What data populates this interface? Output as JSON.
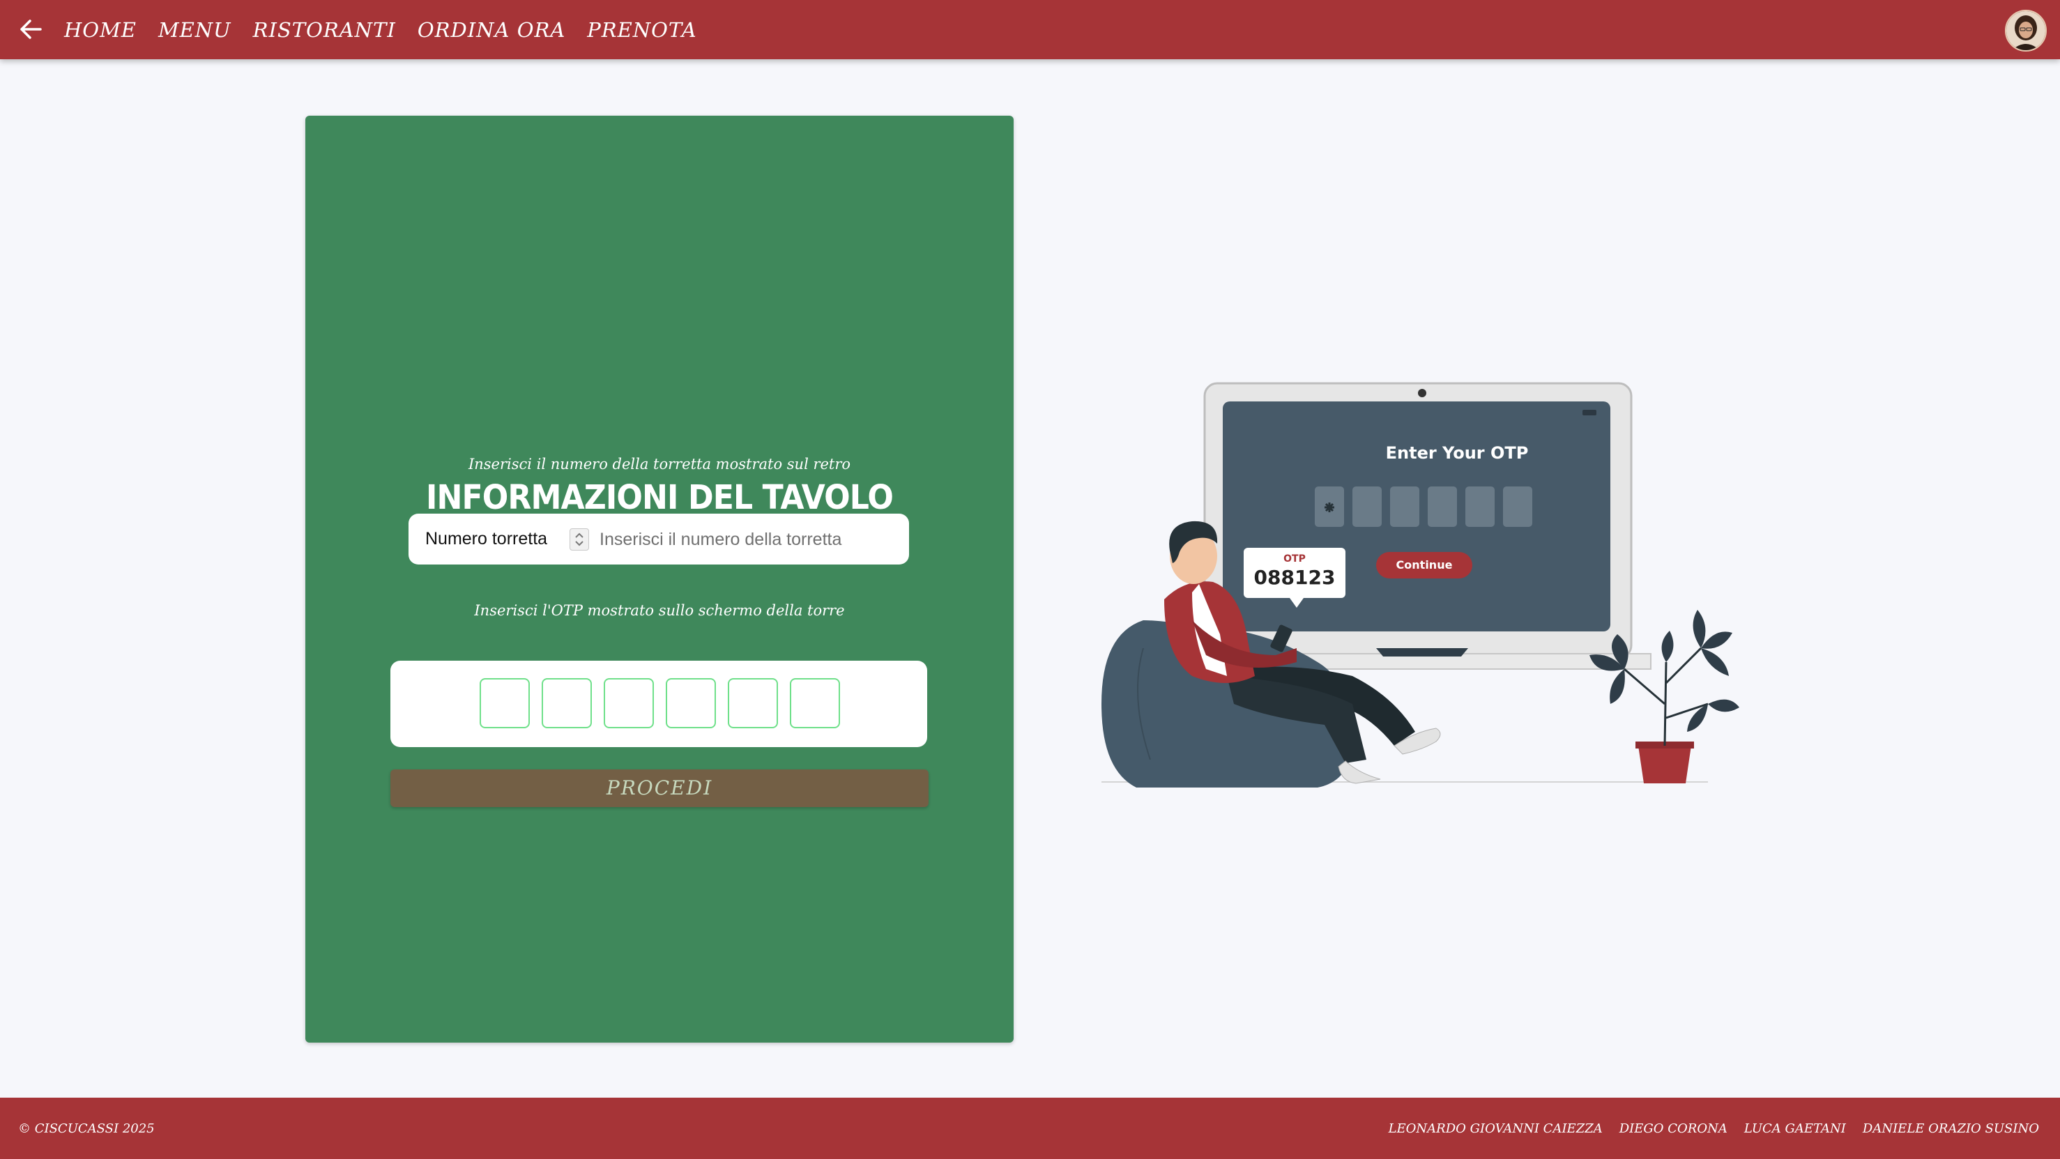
{
  "nav": {
    "back_icon": "arrow-left-icon",
    "links": [
      "HOME",
      "MENU",
      "RISTORANTI",
      "ORDINA ORA",
      "PRENOTA"
    ]
  },
  "card": {
    "title": "INFORMAZIONI DEL TAVOLO",
    "turret_hint": "Inserisci il numero della torretta mostrato sul retro",
    "turret_label": "Numero torretta",
    "turret_placeholder": "Inserisci il numero della torretta",
    "otp_hint": "Inserisci l'OTP mostrato sullo schermo della torre",
    "otp_cells": [
      "",
      "",
      "",
      "",
      "",
      ""
    ],
    "proceed_label": "PROCEDI"
  },
  "illustration": {
    "screen_title": "Enter Your OTP",
    "otp_tag": "OTP",
    "otp_code": "088123",
    "continue_label": "Continue"
  },
  "footer": {
    "copyright": "© CISCUCASSI 2025",
    "authors": [
      "LEONARDO GIOVANNI CAIEZZA",
      "DIEGO CORONA",
      "LUCA GAETANI",
      "DANIELE ORAZIO SUSINO"
    ]
  },
  "colors": {
    "primary": "#a63437",
    "card_green": "#3f885b",
    "proceed_brown": "#735f45",
    "otp_border": "#6fe08a",
    "background": "#f6f7fb"
  }
}
